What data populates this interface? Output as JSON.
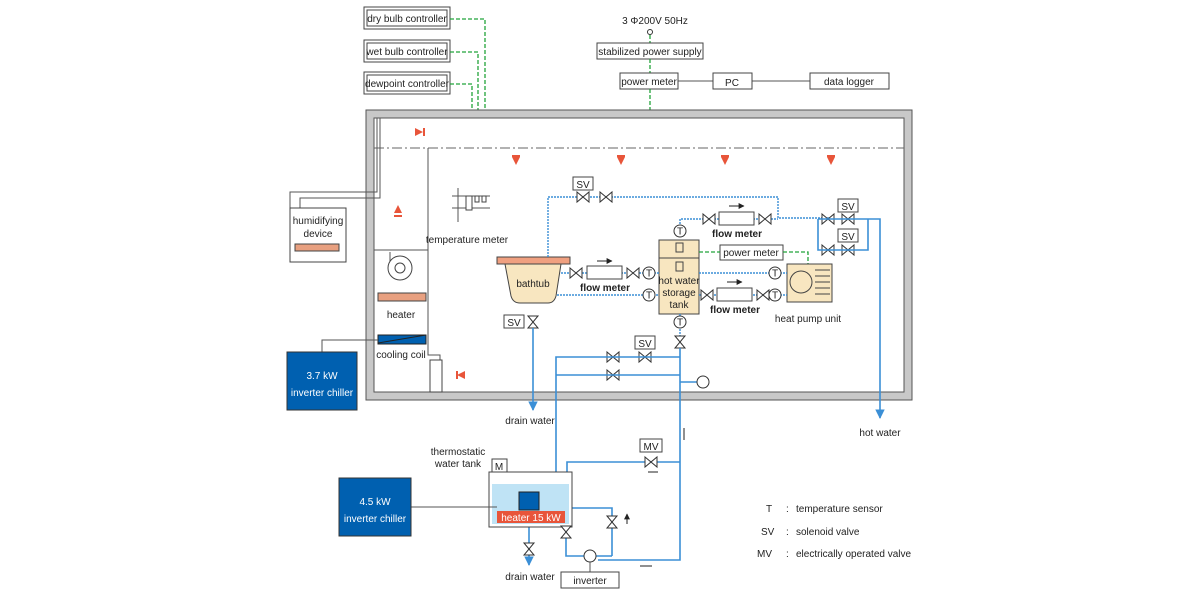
{
  "colors": {
    "chiller": "#0060b0",
    "pipe": "#3b8fd6",
    "signal": "#22a33a",
    "tank": "#f8e6c0",
    "water": "#bfe3f5",
    "heater": "#e8553a",
    "airflow": "#e8553a",
    "room_wall": "#c8c8c8"
  },
  "controllers": [
    "dry bulb controller",
    "wet bulb controller",
    "dewpoint controller"
  ],
  "power": {
    "source": "3 Φ200V 50Hz",
    "supply": "stabilized power supply",
    "meter": "power meter",
    "pc": "PC",
    "logger": "data logger"
  },
  "room": {
    "humidifier": [
      "humidifying",
      "device"
    ],
    "temperature_meter": "temperature meter",
    "heater": "heater",
    "cooling_coil": "cooling coil",
    "bathtub": "bathtub",
    "flow_meter": "flow meter",
    "tank": [
      "hot water",
      "storage",
      "tank"
    ],
    "tank_power_meter": "power meter",
    "heat_pump": "heat pump unit",
    "sv": "SV",
    "t": "T"
  },
  "chiller_small": {
    "power": "3.7 kW",
    "label": "inverter chiller"
  },
  "chiller_large": {
    "power": "4.5 kW",
    "label": "inverter chiller"
  },
  "outside": {
    "drain_water": "drain water",
    "hot_water": "hot water",
    "thermostatic_tank": [
      "thermostatic",
      "water tank"
    ],
    "motor": "M",
    "tank_heater": "heater 15 kW",
    "mv": "MV",
    "inverter": "inverter"
  },
  "legend": [
    {
      "key": "T",
      "desc": "temperature sensor"
    },
    {
      "key": "SV",
      "desc": "solenoid valve"
    },
    {
      "key": "MV",
      "desc": "electrically operated valve"
    }
  ]
}
